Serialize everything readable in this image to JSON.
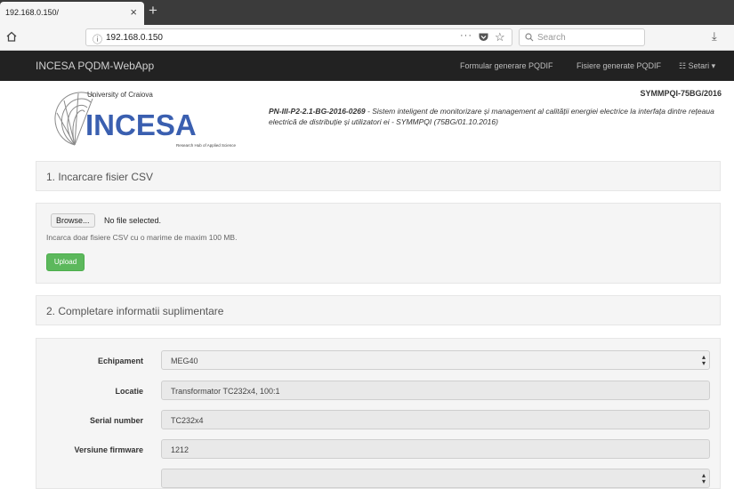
{
  "browser": {
    "tab_title": "192.168.0.150/",
    "tab_close": "×",
    "new_tab": "+",
    "url_info": "ⓘ",
    "url": "192.168.0.150",
    "url_more": "···",
    "star": "☆",
    "search_placeholder": "Search",
    "download": "⤓"
  },
  "app": {
    "brand": "INCESA PQDM-WebApp",
    "nav": [
      "Formular generare PQDIF",
      "Fisiere generate PQDIF",
      "☷ Setari ▾"
    ]
  },
  "header": {
    "logo_university": "University of Craiova",
    "logo_name": "INCESA",
    "logo_tagline": "Research Hub of Applied Science",
    "project_code": "SYMMPQI-75BG/2016",
    "project_id": "PN-III-P2-2.1-BG-2016-0269",
    "project_desc": " - Sistem inteligent de monitorizare și management al calității energiei electrice la interfața dintre rețeaua electrică de distribuție și utilizatori ei - SYMMPQI (75BG/01.10.2016)"
  },
  "section1": {
    "title": "1. Incarcare fisier CSV",
    "browse_label": "Browse...",
    "no_file": "No file selected.",
    "help": "Incarca doar fisiere CSV cu o marime de maxim 100 MB.",
    "upload_label": "Upload"
  },
  "section2": {
    "title": "2. Completare informatii suplimentare",
    "fields": [
      {
        "label": "Echipament",
        "value": "MEG40"
      },
      {
        "label": "Locatie",
        "value": "Transformator TC232x4, 100:1"
      },
      {
        "label": "Serial number",
        "value": "TC232x4"
      },
      {
        "label": "Versiune firmware",
        "value": "1212"
      }
    ]
  },
  "colors": {
    "appbar": "#222222",
    "upload_button": "#5cb85c",
    "logo_blue": "#3a5fb0"
  }
}
